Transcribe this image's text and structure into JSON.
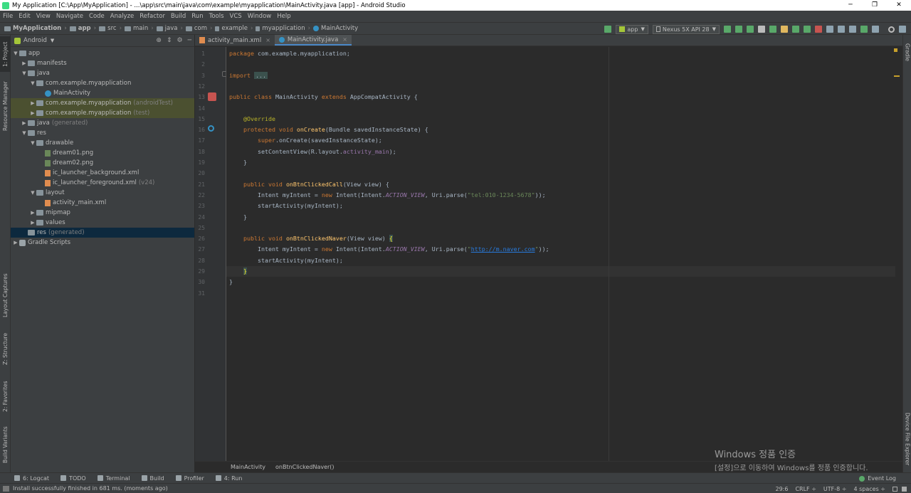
{
  "window": {
    "title": "My Application [C:\\App\\MyApplication] - ...\\app\\src\\main\\java\\com\\example\\myapplication\\MainActivity.java [app] - Android Studio",
    "controls": [
      "─",
      "❐",
      "✕"
    ]
  },
  "menu": [
    "File",
    "Edit",
    "View",
    "Navigate",
    "Code",
    "Analyze",
    "Refactor",
    "Build",
    "Run",
    "Tools",
    "VCS",
    "Window",
    "Help"
  ],
  "breadcrumb": [
    {
      "label": "MyApplication",
      "icon": "folder-icon"
    },
    {
      "label": "app",
      "icon": "folder-icon"
    },
    {
      "label": "src",
      "icon": "folder-icon"
    },
    {
      "label": "main",
      "icon": "folder-icon"
    },
    {
      "label": "java",
      "icon": "folder-icon"
    },
    {
      "label": "com",
      "icon": "folder-icon"
    },
    {
      "label": "example",
      "icon": "package-icon"
    },
    {
      "label": "myapplication",
      "icon": "package-icon"
    },
    {
      "label": "MainActivity",
      "icon": "class-icon"
    }
  ],
  "toolbar": {
    "run_config": "app",
    "device": "Nexus 5X API 28",
    "icon_colors": [
      "#59a869",
      "#59a869",
      "#59a869",
      "#bbbbbb",
      "#59a869",
      "#e0b85f",
      "#59a869",
      "#59a869",
      "#c75450"
    ]
  },
  "project_panel": {
    "view_mode": "Android",
    "tree": [
      {
        "depth": 0,
        "arrow": "▼",
        "icon": "folder",
        "label": "app",
        "suffix": ""
      },
      {
        "depth": 1,
        "arrow": "▶",
        "icon": "folder",
        "label": "manifests",
        "suffix": ""
      },
      {
        "depth": 1,
        "arrow": "▼",
        "icon": "folder",
        "label": "java",
        "suffix": ""
      },
      {
        "depth": 2,
        "arrow": "▼",
        "icon": "folder",
        "label": "com.example.myapplication",
        "suffix": ""
      },
      {
        "depth": 3,
        "arrow": "",
        "icon": "class",
        "label": "MainActivity",
        "suffix": ""
      },
      {
        "depth": 2,
        "arrow": "▶",
        "icon": "folder",
        "label": "com.example.myapplication",
        "suffix": "(androidTest)",
        "hl": true
      },
      {
        "depth": 2,
        "arrow": "▶",
        "icon": "folder",
        "label": "com.example.myapplication",
        "suffix": "(test)",
        "hl": true
      },
      {
        "depth": 1,
        "arrow": "▶",
        "icon": "folder",
        "label": "java",
        "suffix": "(generated)"
      },
      {
        "depth": 1,
        "arrow": "▼",
        "icon": "folder",
        "label": "res",
        "suffix": ""
      },
      {
        "depth": 2,
        "arrow": "▼",
        "icon": "folder",
        "label": "drawable",
        "suffix": ""
      },
      {
        "depth": 3,
        "arrow": "",
        "icon": "image",
        "label": "dream01.png",
        "suffix": ""
      },
      {
        "depth": 3,
        "arrow": "",
        "icon": "image",
        "label": "dream02.png",
        "suffix": ""
      },
      {
        "depth": 3,
        "arrow": "",
        "icon": "xml",
        "label": "ic_launcher_background.xml",
        "suffix": ""
      },
      {
        "depth": 3,
        "arrow": "",
        "icon": "xml",
        "label": "ic_launcher_foreground.xml",
        "suffix": "(v24)"
      },
      {
        "depth": 2,
        "arrow": "▼",
        "icon": "folder",
        "label": "layout",
        "suffix": ""
      },
      {
        "depth": 3,
        "arrow": "",
        "icon": "xml",
        "label": "activity_main.xml",
        "suffix": ""
      },
      {
        "depth": 2,
        "arrow": "▶",
        "icon": "folder",
        "label": "mipmap",
        "suffix": ""
      },
      {
        "depth": 2,
        "arrow": "▶",
        "icon": "folder",
        "label": "values",
        "suffix": ""
      },
      {
        "depth": 1,
        "arrow": "",
        "icon": "folder",
        "label": "res",
        "suffix": "(generated)",
        "sel": true
      },
      {
        "depth": 0,
        "arrow": "▶",
        "icon": "gradle",
        "label": "Gradle Scripts",
        "suffix": ""
      }
    ]
  },
  "left_tabs": [
    "1: Project",
    "Resource Manager",
    "Layout Captures",
    "Z: Structure",
    "2: Favorites",
    "Build Variants"
  ],
  "right_tabs": [
    "Gradle",
    "Device File Explorer"
  ],
  "editor_tabs": [
    {
      "label": "activity_main.xml",
      "icon": "xml",
      "active": false
    },
    {
      "label": "MainActivity.java",
      "icon": "class",
      "active": true
    }
  ],
  "code_lines": [
    {
      "n": "1",
      "segs": [
        [
          "kw",
          "package "
        ],
        [
          "plain",
          "com.example.myapplication;"
        ]
      ]
    },
    {
      "n": "2",
      "segs": []
    },
    {
      "n": "3",
      "segs": [
        [
          "kw",
          "import "
        ],
        [
          "fold",
          "..."
        ]
      ]
    },
    {
      "n": "12",
      "segs": []
    },
    {
      "n": "13",
      "segs": [
        [
          "kw",
          "public class "
        ],
        [
          "plain",
          "MainActivity "
        ],
        [
          "kw",
          "extends "
        ],
        [
          "plain",
          "AppCompatActivity {"
        ]
      ]
    },
    {
      "n": "14",
      "segs": []
    },
    {
      "n": "15",
      "segs": [
        [
          "plain",
          "    "
        ],
        [
          "ann",
          "@Override"
        ]
      ]
    },
    {
      "n": "16",
      "segs": [
        [
          "plain",
          "    "
        ],
        [
          "kw",
          "protected void "
        ],
        [
          "fn",
          "onCreate"
        ],
        [
          "plain",
          "(Bundle savedInstanceState) {"
        ]
      ]
    },
    {
      "n": "17",
      "segs": [
        [
          "plain",
          "        "
        ],
        [
          "kw",
          "super"
        ],
        [
          "plain",
          ".onCreate(savedInstanceState);"
        ]
      ]
    },
    {
      "n": "18",
      "segs": [
        [
          "plain",
          "        setContentView(R.layout."
        ],
        [
          "fld",
          "activity_main"
        ],
        [
          "plain",
          ");"
        ]
      ]
    },
    {
      "n": "19",
      "segs": [
        [
          "plain",
          "    }"
        ]
      ]
    },
    {
      "n": "20",
      "segs": []
    },
    {
      "n": "21",
      "segs": [
        [
          "plain",
          "    "
        ],
        [
          "kw",
          "public void "
        ],
        [
          "fn",
          "onBtnClickedCall"
        ],
        [
          "plain",
          "(View view) {"
        ]
      ]
    },
    {
      "n": "22",
      "segs": [
        [
          "plain",
          "        Intent myIntent = "
        ],
        [
          "kw",
          "new "
        ],
        [
          "plain",
          "Intent(Intent."
        ],
        [
          "const",
          "ACTION_VIEW"
        ],
        [
          "plain",
          ", Uri.parse("
        ],
        [
          "str",
          "\"tel:010-1234-5678\""
        ],
        [
          "plain",
          "));"
        ]
      ]
    },
    {
      "n": "23",
      "segs": [
        [
          "plain",
          "        startActivity(myIntent);"
        ]
      ]
    },
    {
      "n": "24",
      "segs": [
        [
          "plain",
          "    }"
        ]
      ]
    },
    {
      "n": "25",
      "segs": []
    },
    {
      "n": "26",
      "segs": [
        [
          "plain",
          "    "
        ],
        [
          "kw",
          "public void "
        ],
        [
          "fn",
          "onBtnClickedNaver"
        ],
        [
          "plain",
          "(View view) "
        ],
        [
          "brace",
          "{"
        ]
      ]
    },
    {
      "n": "27",
      "segs": [
        [
          "plain",
          "        Intent myIntent = "
        ],
        [
          "kw",
          "new "
        ],
        [
          "plain",
          "Intent(Intent."
        ],
        [
          "const",
          "ACTION_VIEW"
        ],
        [
          "plain",
          ", Uri.parse("
        ],
        [
          "str",
          "\""
        ],
        [
          "link",
          "http://m.naver.com"
        ],
        [
          "str",
          "\""
        ],
        [
          "plain",
          "));"
        ]
      ]
    },
    {
      "n": "28",
      "segs": [
        [
          "plain",
          "        startActivity(myIntent);"
        ]
      ]
    },
    {
      "n": "29",
      "segs": [
        [
          "plain",
          "    "
        ],
        [
          "brace",
          "}"
        ]
      ],
      "caret": true
    },
    {
      "n": "30",
      "segs": [
        [
          "plain",
          "}"
        ]
      ]
    },
    {
      "n": "31",
      "segs": []
    }
  ],
  "editor_breadcrumb": [
    "MainActivity",
    "onBtnClickedNaver()"
  ],
  "watermark": {
    "line1": "Windows 정품 인증",
    "line2": "[설정]으로 이동하여 Windows를 정품 인증합니다."
  },
  "bottom_tools": [
    {
      "label": "6: Logcat",
      "icon": "logcat-icon"
    },
    {
      "label": "TODO",
      "icon": "todo-icon"
    },
    {
      "label": "Terminal",
      "icon": "terminal-icon"
    },
    {
      "label": "Build",
      "icon": "build-icon"
    },
    {
      "label": "Profiler",
      "icon": "profiler-icon"
    },
    {
      "label": "4: Run",
      "icon": "run-icon"
    }
  ],
  "event_log": "Event Log",
  "status": {
    "message": "Install successfully finished in 681 ms. (moments ago)",
    "position": "29:6",
    "line_sep": "CRLF ÷",
    "encoding": "UTF-8 ÷",
    "indent": "4 spaces ÷"
  }
}
